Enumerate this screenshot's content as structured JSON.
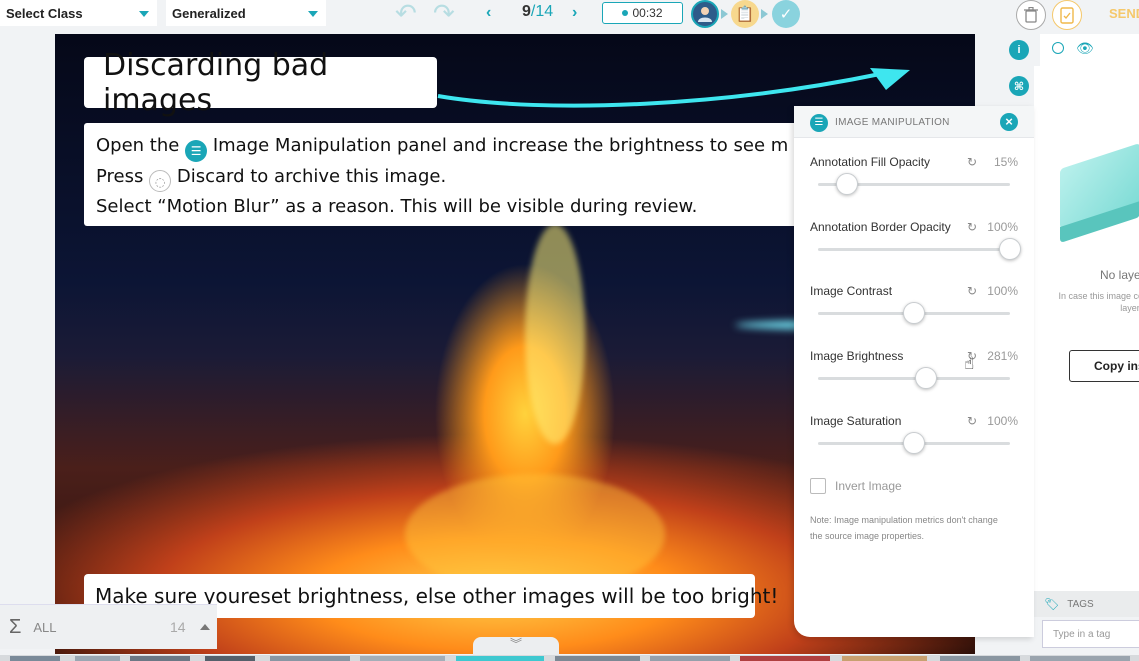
{
  "toolbar": {
    "class_select": "Select Class",
    "mode_select": "Generalized",
    "undo_icon": "undo-icon",
    "redo_icon": "redo-icon",
    "current_image": "9",
    "total_images": "/14",
    "timer": "00:32",
    "send_label": "SEND"
  },
  "canvas": {
    "title": "Discarding bad images",
    "instruction": {
      "line1_a": "Open the",
      "line1_b": "Image Manipulation panel and increase the brightness to see m",
      "line2_a": "Press",
      "line2_b": "Discard to archive this image.",
      "line3": "Select “Motion Blur” as a reason. This will be visible during review."
    },
    "bottom_note_a": "Make sure you",
    "bottom_note_b": "reset brightness, else other images will be too bright!"
  },
  "panel": {
    "title": "IMAGE MANIPULATION",
    "controls": [
      {
        "label": "Annotation Fill Opacity",
        "value": "15%",
        "level": 0.15
      },
      {
        "label": "Annotation Border Opacity",
        "value": "100%",
        "level": 1.0
      },
      {
        "label": "Image Contrast",
        "value": "100%",
        "level": 0.5
      },
      {
        "label": "Image Brightness",
        "value": "281%",
        "level": 0.56
      },
      {
        "label": "Image Saturation",
        "value": "100%",
        "level": 0.5
      }
    ],
    "invert_label": "Invert Image",
    "note": "Note: Image manipulation metrics don't change the source image properties."
  },
  "layers": {
    "empty_title": "No laye",
    "empty_desc": "In case this image co to the previous imag the layers from the",
    "copy_button": "Copy ins"
  },
  "tags": {
    "header": "TAGS",
    "placeholder": "Type in a tag"
  },
  "filter": {
    "label": "ALL",
    "count": "14"
  },
  "colors": {
    "accent": "#1aa6b7",
    "warning": "#f5c86b"
  }
}
